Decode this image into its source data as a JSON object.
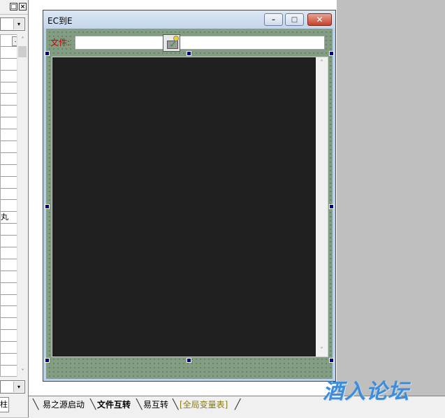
{
  "left_panel": {
    "close_glyph": "×",
    "restore_glyph": "□",
    "combo_arrow": "▾",
    "prop_button": "…",
    "rows": [
      "",
      "",
      "",
      "",
      "",
      "",
      "",
      "",
      "",
      "",
      "",
      "",
      "",
      "",
      "",
      "",
      "",
      "",
      "",
      "",
      "",
      "",
      "",
      "",
      "",
      "",
      "",
      "",
      ""
    ],
    "row_fragment": "丸",
    "tab_label": "柱"
  },
  "form": {
    "title": "EC到E",
    "minimize_glyph": "–",
    "maximize_glyph": "□",
    "close_glyph": "✕",
    "file_label": "文件:",
    "file_value": "",
    "colors": {
      "client": "#829d82",
      "editor": "#202020",
      "label": "#cc0000"
    }
  },
  "scrollbar": {
    "up": "˄",
    "down": "˅"
  },
  "tabs": [
    {
      "label": "易之源启动",
      "active": false
    },
    {
      "label": "文件互转",
      "active": true
    },
    {
      "label": "易互转",
      "active": false
    },
    {
      "label": "[全局变量表]",
      "active": false,
      "color": "#8a7a10"
    }
  ],
  "watermark": "酒入论坛"
}
